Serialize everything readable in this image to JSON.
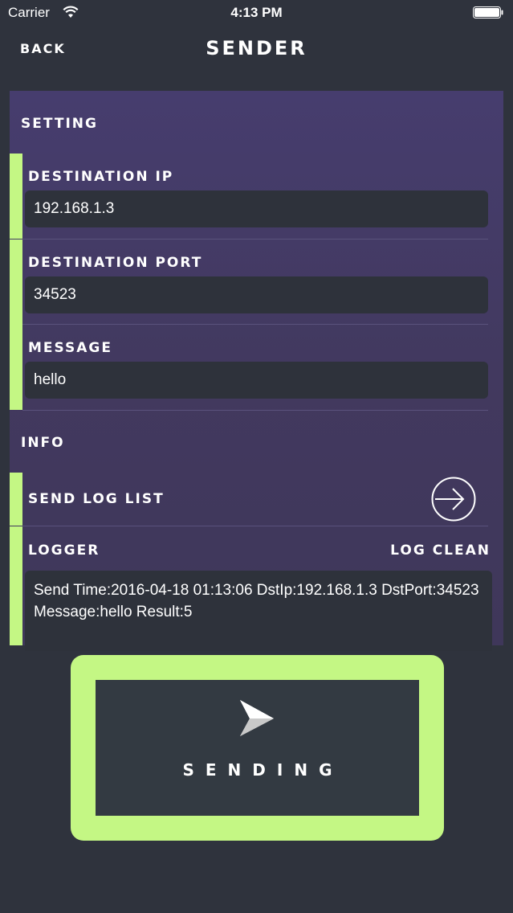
{
  "status": {
    "carrier": "Carrier",
    "time": "4:13 PM"
  },
  "nav": {
    "back_label": "BACK",
    "title": "SENDER"
  },
  "setting": {
    "heading": "SETTING",
    "destination_ip": {
      "label": "DESTINATION IP",
      "value": "192.168.1.3"
    },
    "destination_port": {
      "label": "DESTINATION PORT",
      "value": "34523"
    },
    "message": {
      "label": "MESSAGE",
      "value": "hello"
    }
  },
  "info": {
    "heading": "INFO",
    "send_log_list_label": "SEND LOG LIST",
    "logger_label": "LOGGER",
    "log_clean_label": "LOG CLEAN",
    "log_text": "Send Time:2016-04-18 01:13:06 DstIp:192.168.1.3 DstPort:34523 Message:hello Result:5"
  },
  "send_button": {
    "label": "SENDING"
  },
  "colors": {
    "accent": "#c4f784",
    "panel": "#463d6e",
    "background": "#2f333d",
    "field": "#2e323b"
  },
  "icons": [
    "wifi-icon",
    "battery-icon",
    "arrow-right-circle-icon",
    "paper-plane-icon"
  ]
}
